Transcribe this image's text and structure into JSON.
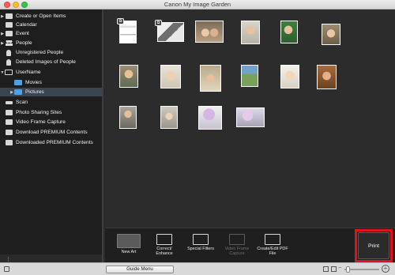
{
  "window": {
    "title": "Canon My Image Garden"
  },
  "sidebar": {
    "items": [
      {
        "label": "Create or Open Items",
        "arrow": "▶",
        "icon": "folder-icon"
      },
      {
        "label": "Calendar",
        "arrow": "",
        "icon": "calendar-icon"
      },
      {
        "label": "Event",
        "arrow": "▶",
        "icon": "event-icon"
      },
      {
        "label": "People",
        "arrow": "▶",
        "icon": "people-icon"
      },
      {
        "label": "Unregistered People",
        "arrow": "",
        "icon": "person-icon"
      },
      {
        "label": "Deleted Images of People",
        "arrow": "",
        "icon": "person-icon"
      },
      {
        "label": "UserName",
        "arrow": "▼",
        "icon": "computer-icon"
      },
      {
        "label": "Movies",
        "arrow": "",
        "icon": "folder-icon"
      },
      {
        "label": "Pictures",
        "arrow": "▶",
        "icon": "folder-icon"
      },
      {
        "label": "Scan",
        "arrow": "",
        "icon": "scan-icon"
      },
      {
        "label": "Photo Sharing Sites",
        "arrow": "",
        "icon": "photo-sharing-icon"
      },
      {
        "label": "Video Frame Capture",
        "arrow": "",
        "icon": "video-frame-icon"
      },
      {
        "label": "Download PREMIUM Contents",
        "arrow": "",
        "icon": "download-icon"
      },
      {
        "label": "Downloaded PREMIUM Contents",
        "arrow": "",
        "icon": "downloaded-icon"
      }
    ],
    "footer_icon": "sidebar-menu-icon"
  },
  "toolbar": {
    "new_art": "New Art",
    "correct_enhance": "Correct/ Enhance",
    "special_filters": "Special Filters",
    "video_frame_capture": "Video Frame Capture",
    "create_edit_pdf": "Create/Edit PDF File",
    "print": "Print"
  },
  "bottom": {
    "guide_menu": "Guide Menu"
  },
  "colors": {
    "highlight": "#e0121d",
    "selected_row": "#3d4451",
    "folder_blue": "#4aa3e8"
  }
}
